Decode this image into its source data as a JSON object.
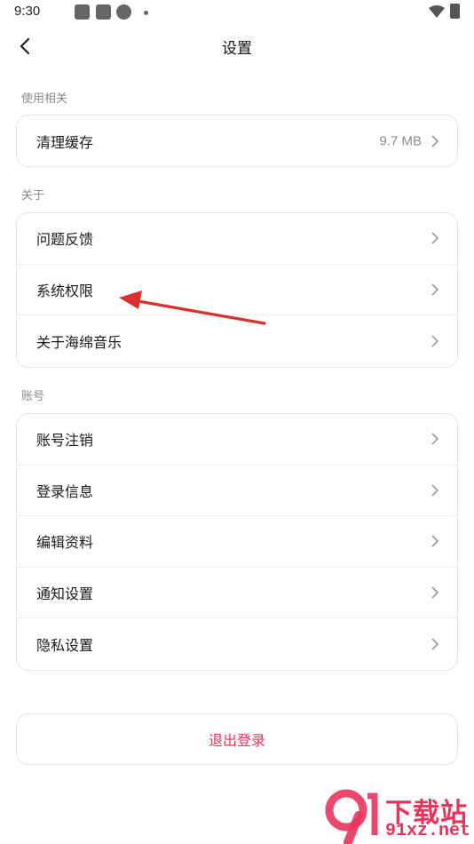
{
  "status_bar": {
    "time": "9:30"
  },
  "header": {
    "title": "设置"
  },
  "sections": [
    {
      "label": "使用相关",
      "items": [
        {
          "label": "清理缓存",
          "value": "9.7 MB"
        }
      ]
    },
    {
      "label": "关于",
      "items": [
        {
          "label": "问题反馈"
        },
        {
          "label": "系统权限"
        },
        {
          "label": "关于海绵音乐"
        }
      ]
    },
    {
      "label": "账号",
      "items": [
        {
          "label": "账号注销"
        },
        {
          "label": "登录信息"
        },
        {
          "label": "编辑资料"
        },
        {
          "label": "通知设置"
        },
        {
          "label": "隐私设置"
        }
      ]
    }
  ],
  "logout": {
    "label": "退出登录"
  },
  "watermark": {
    "brand": "下载站",
    "url": "91xz.net"
  },
  "colors": {
    "accent": "#e8345c",
    "annotation_arrow": "#d9302b"
  }
}
